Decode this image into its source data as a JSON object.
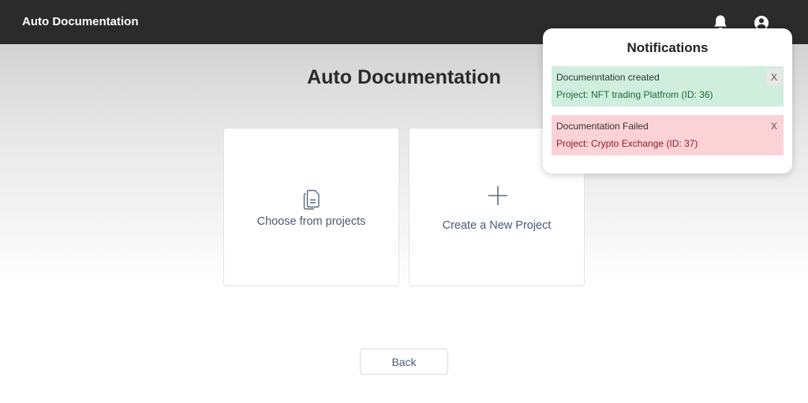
{
  "header": {
    "app_title": "Auto Documentation",
    "bell_icon": "bell-icon",
    "user_icon": "user-circle-icon",
    "background": "#2b2b2b"
  },
  "main": {
    "title": "Auto Documentation",
    "cards": [
      {
        "label": "Choose from projects",
        "icon": "documents-icon"
      },
      {
        "label": "Create a New Project",
        "icon": "plus-icon"
      }
    ],
    "back_label": "Back"
  },
  "notifications": {
    "title": "Notifications",
    "items": [
      {
        "heading": "Documenntation created",
        "detail": "Project: NFT trading Platfrom (ID: 36)",
        "status": "success",
        "close_label": "X",
        "color": "#cfeedd"
      },
      {
        "heading": "Documentation Failed",
        "detail": "Project: Crypto Exchange (ID: 37)",
        "status": "error",
        "close_label": "X",
        "color": "#fbd2d6"
      }
    ]
  },
  "colors": {
    "accent_text": "#4a5b70",
    "success_text": "#1e6b35",
    "error_text": "#8e1e2a"
  }
}
